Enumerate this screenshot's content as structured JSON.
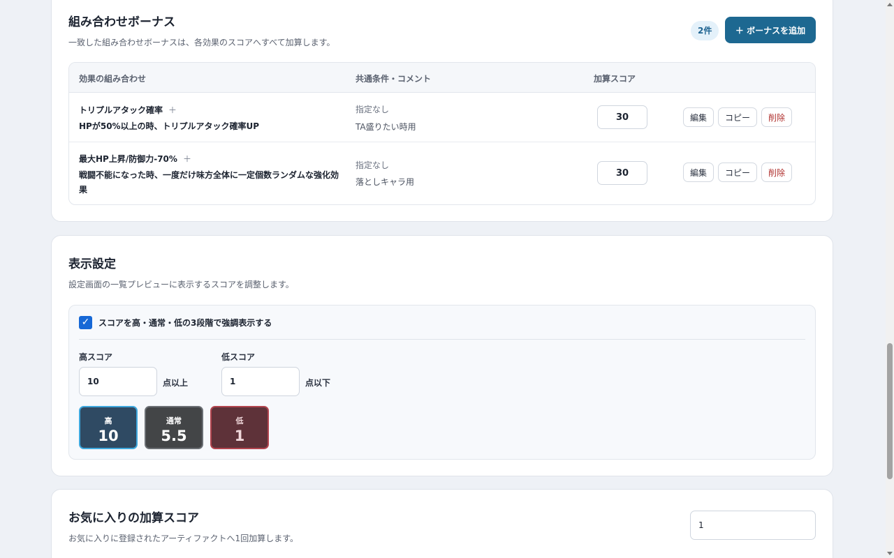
{
  "bonus_section": {
    "title": "組み合わせボーナス",
    "description": "一致した組み合わせボーナスは、各効果のスコアへすべて加算します。",
    "count_badge": "2件",
    "add_button": "＋ ボーナスを追加",
    "columns": [
      "効果の組み合わせ",
      "共通条件・コメント",
      "加算スコア"
    ],
    "rows": [
      {
        "effect_name": "トリプルアタック確率",
        "effect_plus": "＋",
        "effect_desc": "HPが50%以上の時、トリプルアタック確率UP",
        "condition": "指定なし",
        "comment": "TA盛りたい時用",
        "score": "30",
        "edit": "編集",
        "copy": "コピー",
        "delete": "削除"
      },
      {
        "effect_name": "最大HP上昇/防御力-70%",
        "effect_plus": "＋",
        "effect_desc": "戦闘不能になった時、一度だけ味方全体に一定個数ランダムな強化効果",
        "condition": "指定なし",
        "comment": "落としキャラ用",
        "score": "30",
        "edit": "編集",
        "copy": "コピー",
        "delete": "削除"
      }
    ]
  },
  "display_section": {
    "title": "表示設定",
    "description": "設定画面の一覧プレビューに表示するスコアを調整します。",
    "highlight_checkbox": {
      "checked": true,
      "label": "スコアを高・通常・低の3段階で強調表示する"
    },
    "high_score": {
      "label": "高スコア",
      "value": "10",
      "unit": "点以上"
    },
    "low_score": {
      "label": "低スコア",
      "value": "1",
      "unit": "点以下"
    },
    "preview": [
      {
        "label": "高",
        "value": "10"
      },
      {
        "label": "通常",
        "value": "5.5"
      },
      {
        "label": "低",
        "value": "1"
      }
    ]
  },
  "favorite_section": {
    "title": "お気に入りの加算スコア",
    "description": "お気に入りに登録されたアーティファクトへ1回加算します。",
    "value": "1"
  },
  "colors": {
    "primary": "#1d6891",
    "high": "#2f4a63",
    "normal": "#434547",
    "low": "#5e3239",
    "delete": "#b0322f"
  }
}
